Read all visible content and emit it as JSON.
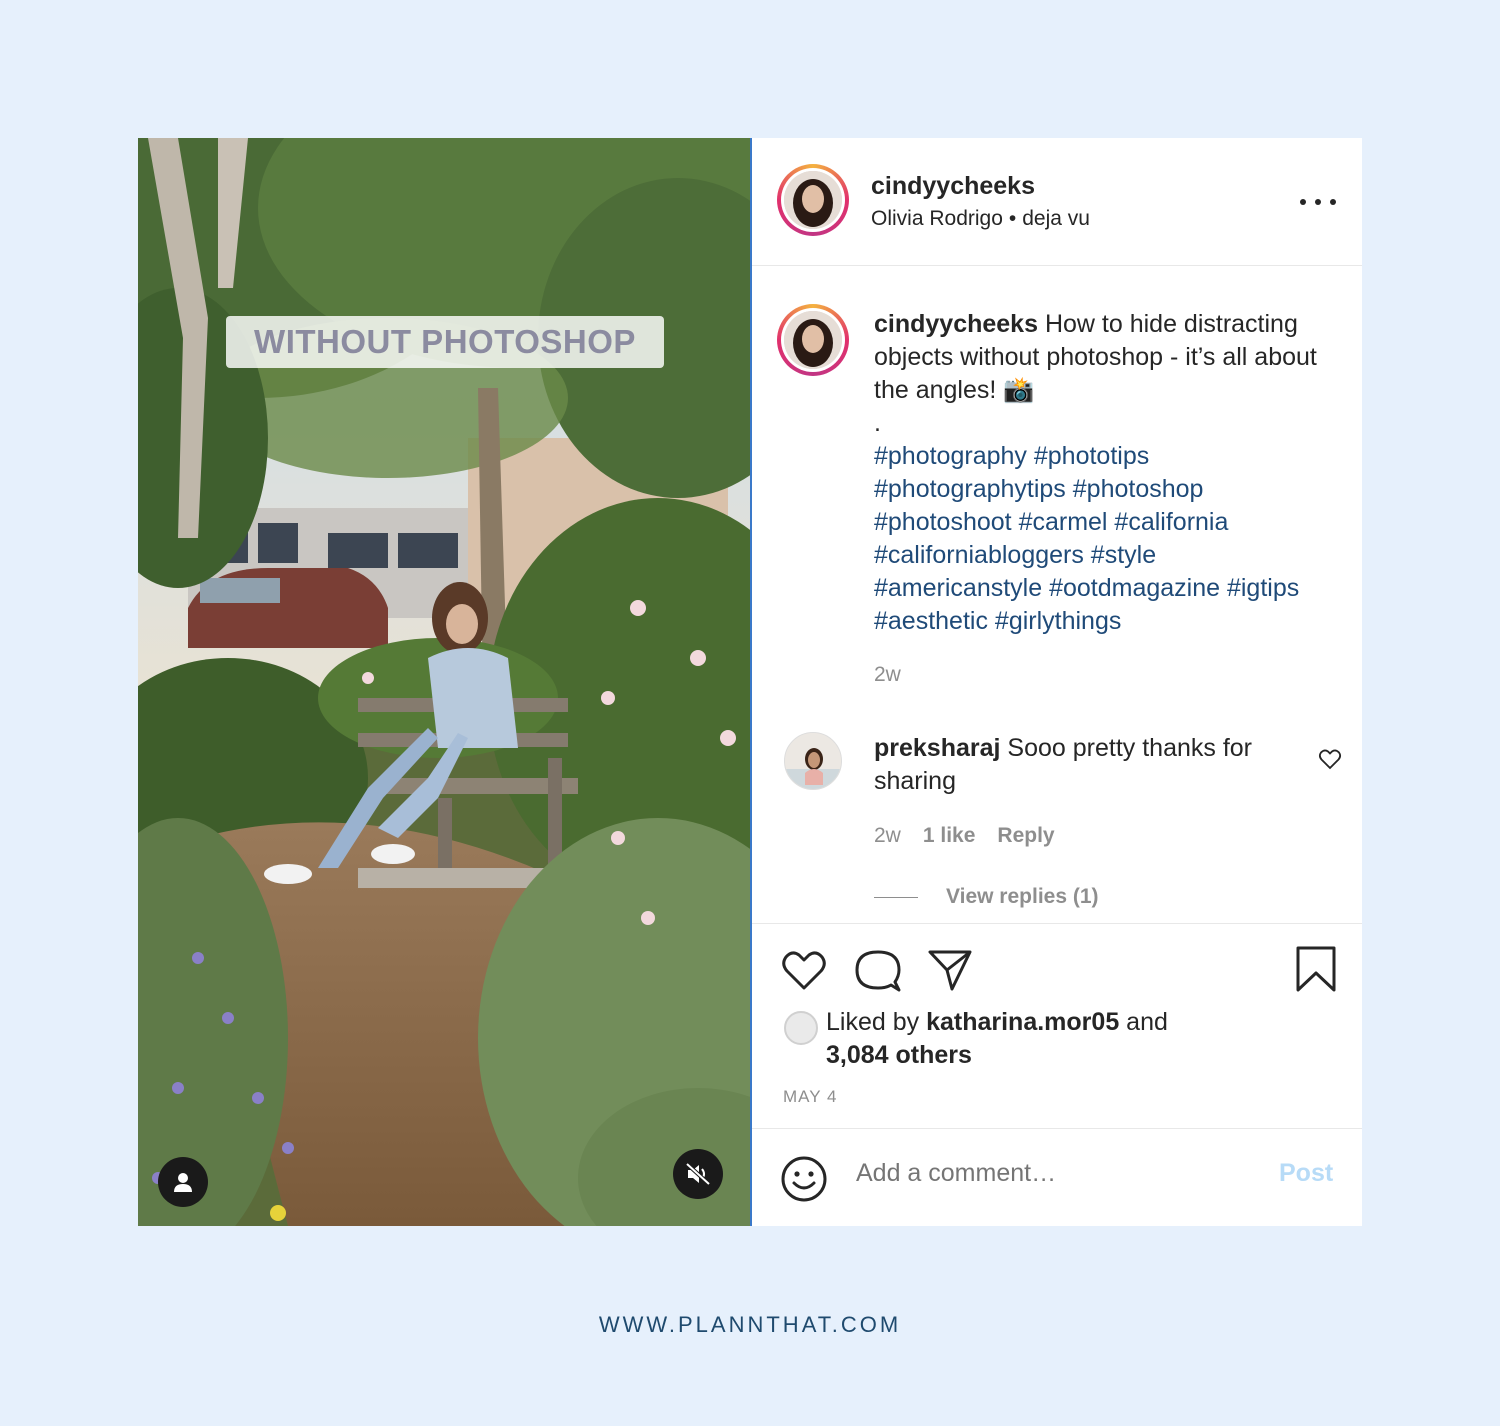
{
  "post": {
    "overlay_text": "WITHOUT PHOTOSHOP",
    "author": {
      "username": "cindyycheeks",
      "music_artist": "Olivia Rodrigo",
      "music_separator": "•",
      "music_title": "deja vu"
    },
    "caption": {
      "username": "cindyycheeks",
      "text": "How to hide distracting objects without photoshop - it’s all about the angles! 📸",
      "dot": ".",
      "hashtag_lines": [
        "#photography #phototips",
        "#photographytips #photoshop",
        "#photoshoot #carmel #california",
        "#californiabloggers #style",
        "#americanstyle #ootdmagazine #igtips",
        "#aesthetic #girlythings"
      ],
      "time": "2w"
    },
    "comment": {
      "username": "preksharaj",
      "text": "Sooo pretty thanks for sharing",
      "time": "2w",
      "likes": "1 like",
      "reply_label": "Reply",
      "view_replies": "View replies (1)"
    },
    "likes": {
      "prefix": "Liked by",
      "user": "katharina.mor05",
      "conjunction": "and",
      "others": "3,084 others"
    },
    "date": "MAY 4",
    "add_comment_placeholder": "Add a comment…",
    "post_button": "Post"
  },
  "footer": {
    "url": "WWW.PLANNTHAT.COM"
  },
  "icons": {
    "tag": "person-icon",
    "mute": "muted-speaker-icon",
    "more": "more-options-icon",
    "like": "heart-icon",
    "comment": "comment-bubble-icon",
    "share": "paper-plane-icon",
    "save": "bookmark-icon",
    "emoji": "smiley-icon"
  },
  "colors": {
    "background": "#e6f0fc",
    "hashtag": "#1f4a78",
    "muted_text": "#8e8e8e",
    "post_button": "#b7dbf7",
    "footer_text": "#1f4a6e"
  }
}
